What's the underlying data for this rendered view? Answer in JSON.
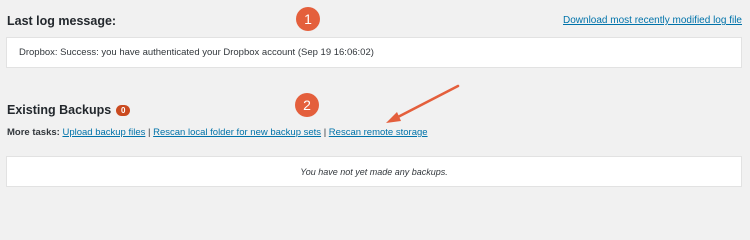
{
  "log_section": {
    "title": "Last log message:",
    "download_link": "Download most recently modified log file",
    "message": "Dropbox: Success: you have authenticated your Dropbox account (Sep 19 16:06:02)"
  },
  "backups_section": {
    "title": "Existing Backups",
    "count_badge": "0",
    "tasks_label": "More tasks:",
    "tasks": [
      {
        "label": "Upload backup files"
      },
      {
        "label": "Rescan local folder for new backup sets"
      },
      {
        "label": "Rescan remote storage"
      }
    ],
    "separator": "|",
    "empty_message": "You have not yet made any backups."
  },
  "annotations": {
    "marker_1": "1",
    "marker_2": "2",
    "color": "#e45f3c"
  }
}
